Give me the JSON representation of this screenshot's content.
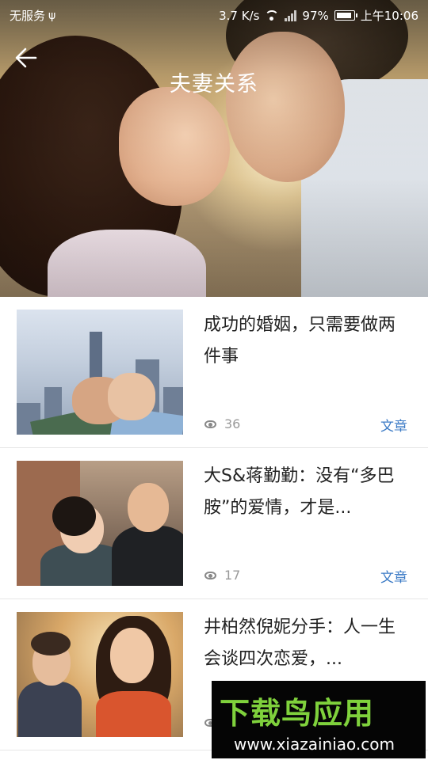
{
  "status_bar": {
    "carrier": "无服务",
    "speed": "3.7 K/s",
    "battery": "97%",
    "time": "上午10:06"
  },
  "header": {
    "title": "夫妻关系"
  },
  "articles": [
    {
      "title": "成功的婚姻，只需要做两件事",
      "views": "36",
      "tag": "文章"
    },
    {
      "title": "大S&蒋勤勤：没有“多巴胺”的爱情，才是...",
      "views": "17",
      "tag": "文章"
    },
    {
      "title": "井柏然倪妮分手：人一生会谈四次恋爱，...",
      "views": "",
      "tag": ""
    }
  ],
  "watermark": {
    "brand": "下载鸟应用",
    "url": "www.xiazainiao.com"
  },
  "colors": {
    "accent": "#3c7bc6",
    "meta_text": "#999999",
    "title_text": "#222222"
  },
  "icons": [
    "back-arrow-icon",
    "usb-icon",
    "wifi-icon",
    "signal-icon",
    "battery-icon",
    "eye-icon"
  ]
}
